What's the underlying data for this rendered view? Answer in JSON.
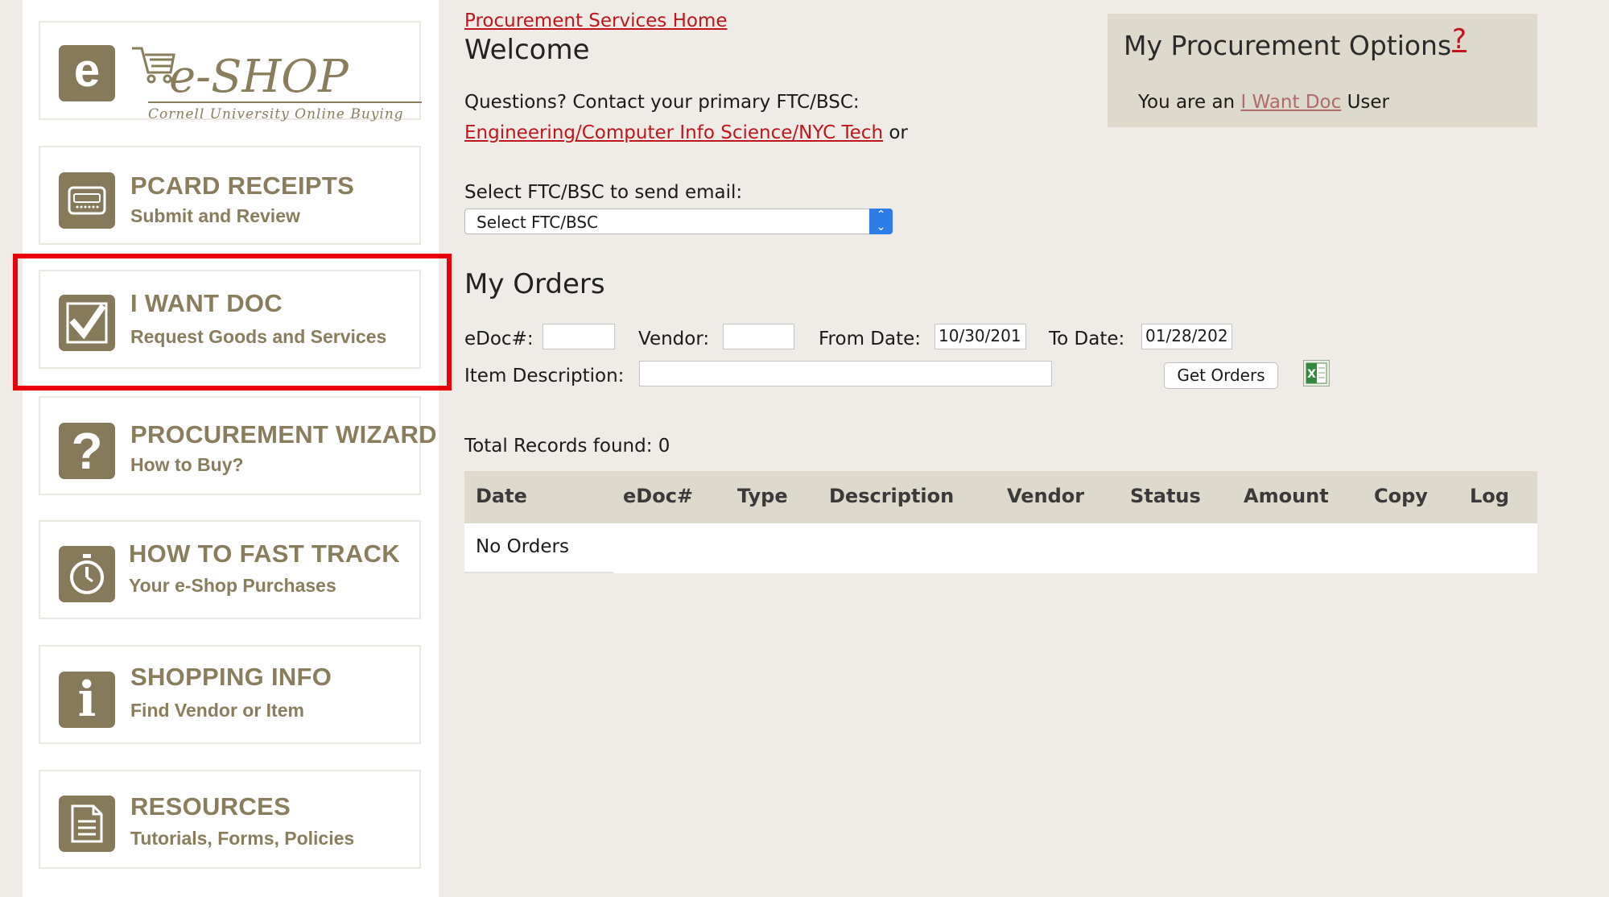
{
  "sidebar": {
    "logo": {
      "letter": "e",
      "title": "e-SHOP",
      "subtitle": "Cornell University Online Buying"
    },
    "items": [
      {
        "title": "PCARD RECEIPTS",
        "subtitle": "Submit and Review",
        "icon": "card-icon"
      },
      {
        "title": "I WANT DOC",
        "subtitle": "Request Goods and Services",
        "icon": "checkmark-icon"
      },
      {
        "title": "PROCUREMENT WIZARD",
        "subtitle": "How to Buy?",
        "icon": "question-icon"
      },
      {
        "title": "HOW TO FAST TRACK",
        "subtitle": "Your e-Shop Purchases",
        "icon": "stopwatch-icon"
      },
      {
        "title": "SHOPPING INFO",
        "subtitle": "Find Vendor or Item",
        "icon": "info-icon"
      },
      {
        "title": "RESOURCES",
        "subtitle": "Tutorials, Forms, Policies",
        "icon": "document-icon"
      }
    ]
  },
  "header": {
    "home_link": "Procurement Services Home",
    "welcome": "Welcome",
    "questions": "Questions? Contact your primary FTC/BSC:",
    "contact_link": "Engineering/Computer Info Science/NYC Tech",
    "contact_suffix": "or"
  },
  "options": {
    "title": "My Procurement Options",
    "help": "?",
    "user_prefix": "You are an",
    "user_link": "I Want Doc",
    "user_suffix": "User"
  },
  "email": {
    "label": "Select FTC/BSC to send email:",
    "select_value": "Select FTC/BSC"
  },
  "orders": {
    "title": "My Orders",
    "edoc_label": "eDoc#:",
    "edoc_value": "",
    "vendor_label": "Vendor:",
    "vendor_value": "",
    "from_label": "From Date:",
    "from_value": "10/30/201",
    "to_label": "To Date:",
    "to_value": "01/28/202",
    "desc_label": "Item Description:",
    "desc_value": "",
    "button": "Get Orders",
    "total_label": "Total Records found: 0",
    "columns": [
      "Date",
      "eDoc#",
      "Type",
      "Description",
      "Vendor",
      "Status",
      "Amount",
      "Copy",
      "Log"
    ],
    "empty": "No Orders"
  },
  "colors": {
    "accent_link": "#c0161b",
    "tile_text": "#8a7d5c",
    "panel": "#dedacb",
    "highlight": "#e8000a",
    "select_arrow": "#2d7de8"
  }
}
